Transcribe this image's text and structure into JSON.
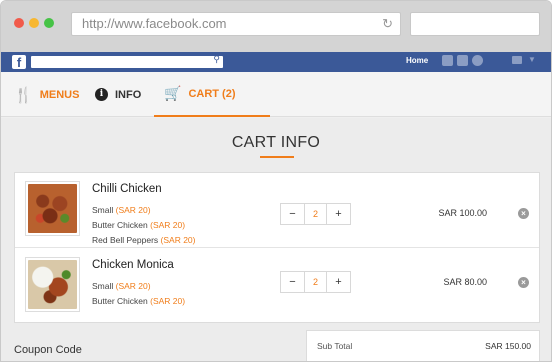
{
  "browser": {
    "url": "http://www.facebook.com"
  },
  "fbbar": {
    "logo": "f",
    "home_label": "Home"
  },
  "nav": {
    "menus_label": "MENUS",
    "info_label": "INFO",
    "cart_label": "CART (2)",
    "active_tab": "cart",
    "accent": "#f07d1a"
  },
  "main": {
    "title": "CART INFO"
  },
  "cart": {
    "items": [
      {
        "name": "Chilli Chicken",
        "options": [
          {
            "label": "Small",
            "price": "(SAR 20)"
          },
          {
            "label": "Butter Chicken",
            "price": "(SAR 20)"
          },
          {
            "label": "Red Bell Peppers",
            "price": "(SAR 20)"
          }
        ],
        "qty": "2",
        "minus": "−",
        "plus": "+",
        "total": "SAR 100.00",
        "remove": "×"
      },
      {
        "name": "Chicken Monica",
        "options": [
          {
            "label": "Small",
            "price": "(SAR 20)"
          },
          {
            "label": "Butter Chicken",
            "price": "(SAR 20)"
          }
        ],
        "qty": "2",
        "minus": "−",
        "plus": "+",
        "total": "SAR 80.00",
        "remove": "×"
      }
    ]
  },
  "footer": {
    "coupon_label": "Coupon Code",
    "subtotal_label": "Sub Total",
    "subtotal_value": "SAR 150.00"
  },
  "colors": {
    "accent": "#f07d1a",
    "facebook_blue": "#3b5998"
  }
}
